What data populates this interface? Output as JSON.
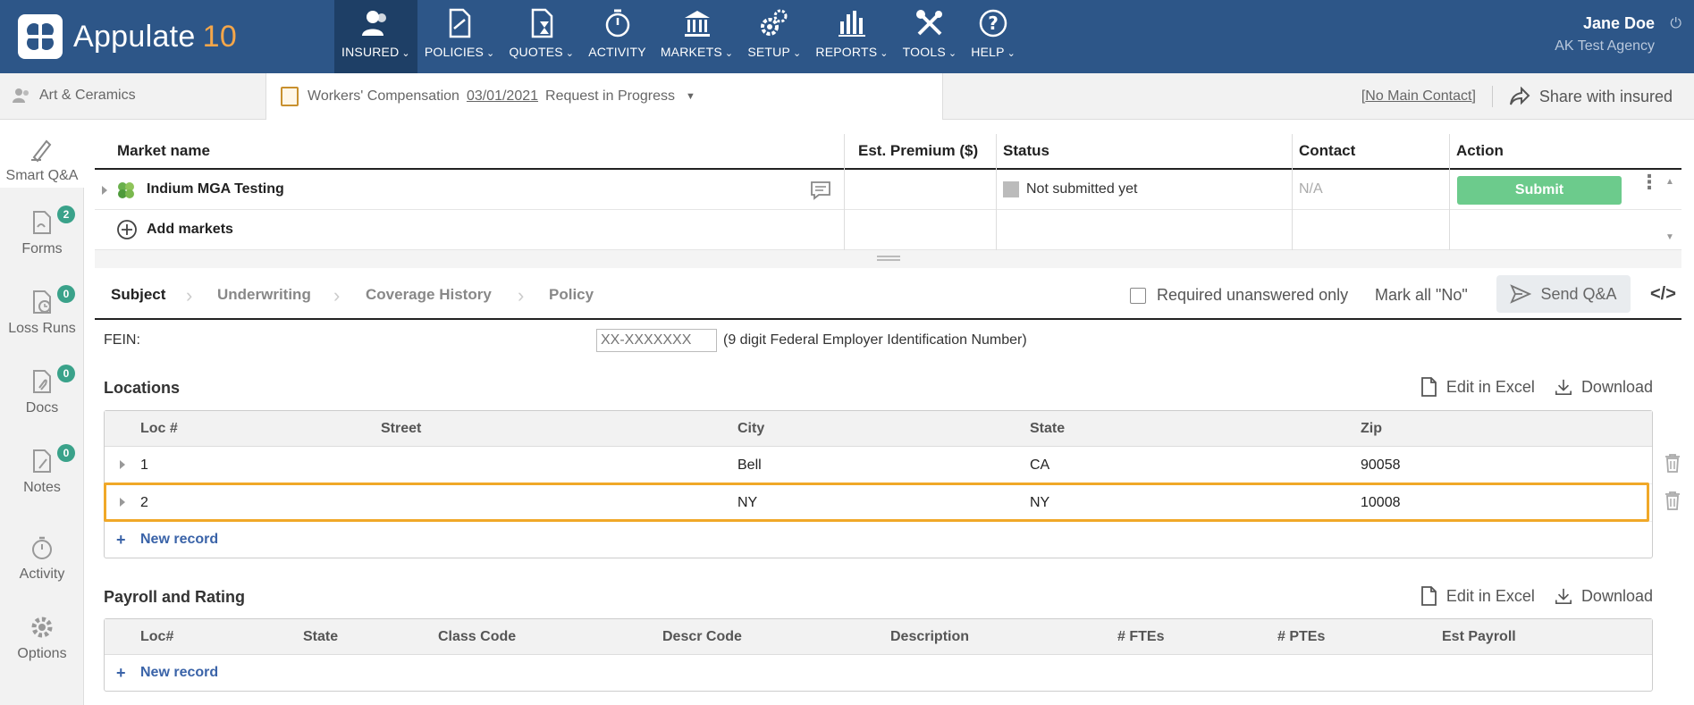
{
  "app": {
    "name": "Appulate",
    "version": "10"
  },
  "nav": [
    {
      "label": "INSURED",
      "icon": "insured-icon",
      "active": true
    },
    {
      "label": "POLICIES",
      "icon": "policies-icon"
    },
    {
      "label": "QUOTES",
      "icon": "quotes-icon"
    },
    {
      "label": "ACTIVITY",
      "icon": "activity-icon"
    },
    {
      "label": "MARKETS",
      "icon": "markets-icon"
    },
    {
      "label": "SETUP",
      "icon": "setup-icon"
    },
    {
      "label": "REPORTS",
      "icon": "reports-icon"
    },
    {
      "label": "TOOLS",
      "icon": "tools-icon"
    },
    {
      "label": "HELP",
      "icon": "help-icon"
    }
  ],
  "user": {
    "name": "Jane Doe",
    "agency": "AK Test Agency"
  },
  "context": {
    "insured": "Art & Ceramics",
    "policy_type": "Workers' Compensation",
    "policy_date": "03/01/2021",
    "policy_status": "Request in Progress",
    "no_main_contact": "No Main Contact",
    "share_label": "Share with insured"
  },
  "sidebar": [
    {
      "label": "Smart Q&A",
      "icon": "smart-qa-icon",
      "active": true
    },
    {
      "label": "Forms",
      "icon": "forms-icon",
      "badge": "2"
    },
    {
      "label": "Loss Runs",
      "icon": "loss-runs-icon",
      "badge": "0"
    },
    {
      "label": "Docs",
      "icon": "docs-icon",
      "badge": "0"
    },
    {
      "label": "Notes",
      "icon": "notes-icon",
      "badge": "0"
    },
    {
      "label": "Activity",
      "icon": "activity-icon"
    },
    {
      "label": "Options",
      "icon": "gear-icon"
    }
  ],
  "markets": {
    "headers": {
      "name": "Market name",
      "premium": "Est. Premium ($)",
      "status": "Status",
      "contact": "Contact",
      "action": "Action"
    },
    "rows": [
      {
        "name": "Indium MGA Testing",
        "premium": "",
        "status": "Not submitted yet",
        "contact": "N/A",
        "action": "Submit"
      }
    ],
    "add_label": "Add markets"
  },
  "tabs": {
    "items": [
      "Subject",
      "Underwriting",
      "Coverage History",
      "Policy"
    ],
    "required_only": "Required unanswered only",
    "mark_all_no": "Mark all \"No\"",
    "send_qa": "Send Q&A",
    "code_icon": "</>"
  },
  "fein": {
    "label": "FEIN:",
    "placeholder": "XX-XXXXXXX",
    "hint": "(9 digit Federal Employer Identification Number)"
  },
  "locations": {
    "title": "Locations",
    "edit_excel": "Edit in Excel",
    "download": "Download",
    "headers": [
      "Loc #",
      "Street",
      "City",
      "State",
      "Zip"
    ],
    "rows": [
      {
        "loc": "1",
        "street": "",
        "city": "Bell",
        "state": "CA",
        "zip": "90058"
      },
      {
        "loc": "2",
        "street": "",
        "city": "NY",
        "state": "NY",
        "zip": "10008"
      }
    ],
    "new_record": "New record"
  },
  "payroll": {
    "title": "Payroll and Rating",
    "edit_excel": "Edit in Excel",
    "download": "Download",
    "headers": [
      "Loc#",
      "State",
      "Class Code",
      "Descr Code",
      "Description",
      "# FTEs",
      "# PTEs",
      "Est Payroll"
    ],
    "new_record": "New record"
  }
}
